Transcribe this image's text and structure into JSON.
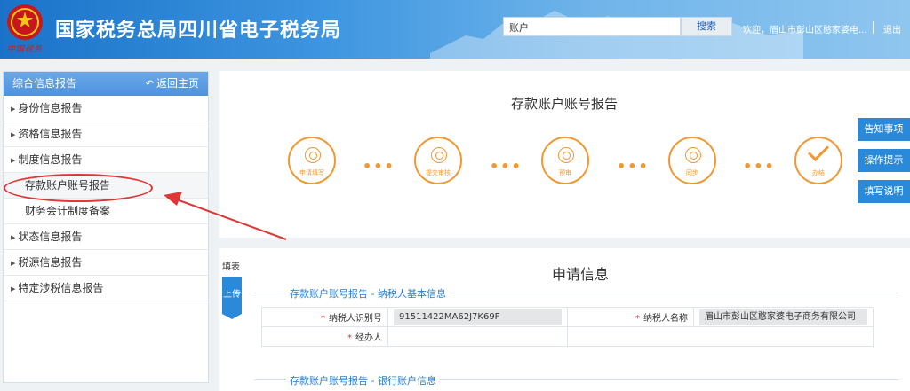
{
  "header": {
    "emblem_caption": "中国税务",
    "title": "国家税务总局四川省电子税务局",
    "search_value": "账户",
    "search_button": "搜索",
    "welcome": "欢迎，眉山市彭山区憨家婆电...",
    "logout": "退出"
  },
  "sidebar": {
    "head_title": "综合信息报告",
    "back_label": "返回主页",
    "items": [
      {
        "label": "身份信息报告"
      },
      {
        "label": "资格信息报告"
      },
      {
        "label": "制度信息报告"
      },
      {
        "label": "存款账户账号报告"
      },
      {
        "label": "财务会计制度备案"
      },
      {
        "label": "状态信息报告"
      },
      {
        "label": "税源信息报告"
      },
      {
        "label": "特定涉税信息报告"
      }
    ]
  },
  "main": {
    "page_title": "存款账户账号报告",
    "steps": [
      {
        "label": "申请填写"
      },
      {
        "label": "提交审核"
      },
      {
        "label": "预审"
      },
      {
        "label": "同步"
      },
      {
        "label": "办结"
      }
    ],
    "dots": "•••",
    "side_buttons": [
      "告知事项",
      "操作提示",
      "填写说明"
    ],
    "fill_label": "填表",
    "upload_label": "上传",
    "application_title": "申请信息",
    "section1_legend": "存款账户账号报告 - 纳税人基本信息",
    "section2_legend": "存款账户账号报告 - 银行账户信息",
    "form": {
      "taxpayer_id_label": "纳税人识别号",
      "taxpayer_id_value": "91511422MA62J7K69F",
      "taxpayer_name_label": "纳税人名称",
      "taxpayer_name_value": "眉山市彭山区憨家婆电子商务有限公司",
      "handler_label": "经办人",
      "required_mark": "*"
    }
  },
  "colors": {
    "header_blue": "#1a73c8",
    "accent_orange": "#f29833",
    "button_blue": "#2a89d8",
    "annotation_red": "#e03636"
  }
}
